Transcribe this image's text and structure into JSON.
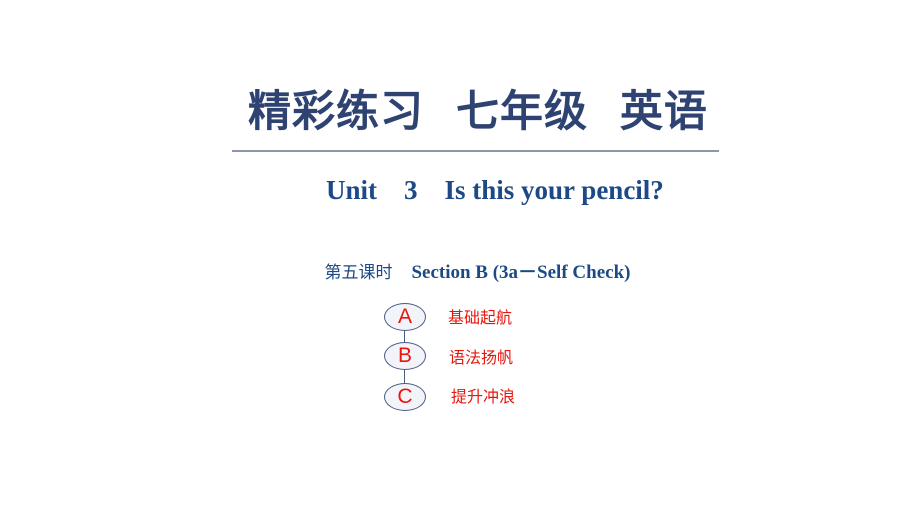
{
  "header": {
    "title": "精彩练习  七年级  英语"
  },
  "lesson": {
    "unit_line": "Unit    3    Is this your pencil?",
    "period_cn": "第五课时",
    "section_en": "    Section B (3a－Self Check)"
  },
  "sections": [
    {
      "letter": "A",
      "label": "基础起航"
    },
    {
      "letter": "B",
      "label": "语法扬帆"
    },
    {
      "letter": "C",
      "label": "提升冲浪"
    }
  ],
  "colors": {
    "title": "#2f4372",
    "subtitle": "#1d4a86",
    "accent_red": "#e8160c",
    "badge_border": "#4a5a80",
    "badge_fill": "#f3f4f9"
  }
}
